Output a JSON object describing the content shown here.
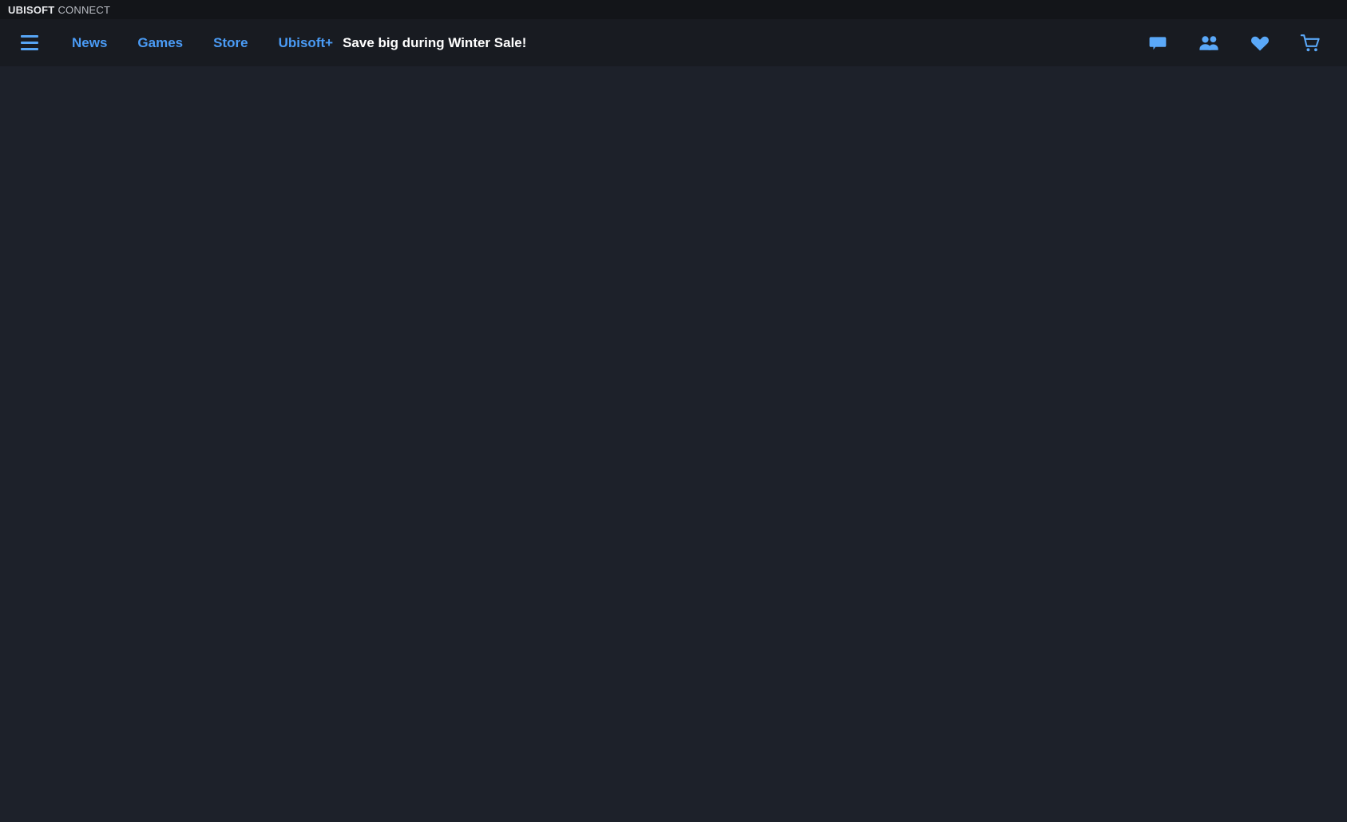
{
  "window": {
    "title_bold": "UBISOFT",
    "title_light": "CONNECT"
  },
  "navbar": {
    "menu_icon": "hamburger-menu-icon",
    "links": [
      {
        "label": "News",
        "name": "news"
      },
      {
        "label": "Games",
        "name": "games"
      },
      {
        "label": "Store",
        "name": "store"
      },
      {
        "label": "Ubisoft+",
        "name": "ubisoft-plus"
      }
    ],
    "promo": "Save big during Winter Sale!",
    "icons": [
      {
        "name": "chat-icon",
        "label": "Chat"
      },
      {
        "name": "friends-icon",
        "label": "Friends"
      },
      {
        "name": "wishlist-heart-icon",
        "label": "Wishlist"
      },
      {
        "name": "shopping-cart-icon",
        "label": "Cart"
      }
    ]
  },
  "main": {
    "content": ""
  },
  "colors": {
    "titlebar_bg": "#131519",
    "navbar_bg": "#181b21",
    "content_bg": "#1d212a",
    "accent_blue": "#4a9bf5",
    "icon_blue": "#5aa8f8",
    "promo_text": "#ffffff",
    "title_bold_text": "#e8e9ec",
    "title_light_text": "#b9bcc3"
  }
}
